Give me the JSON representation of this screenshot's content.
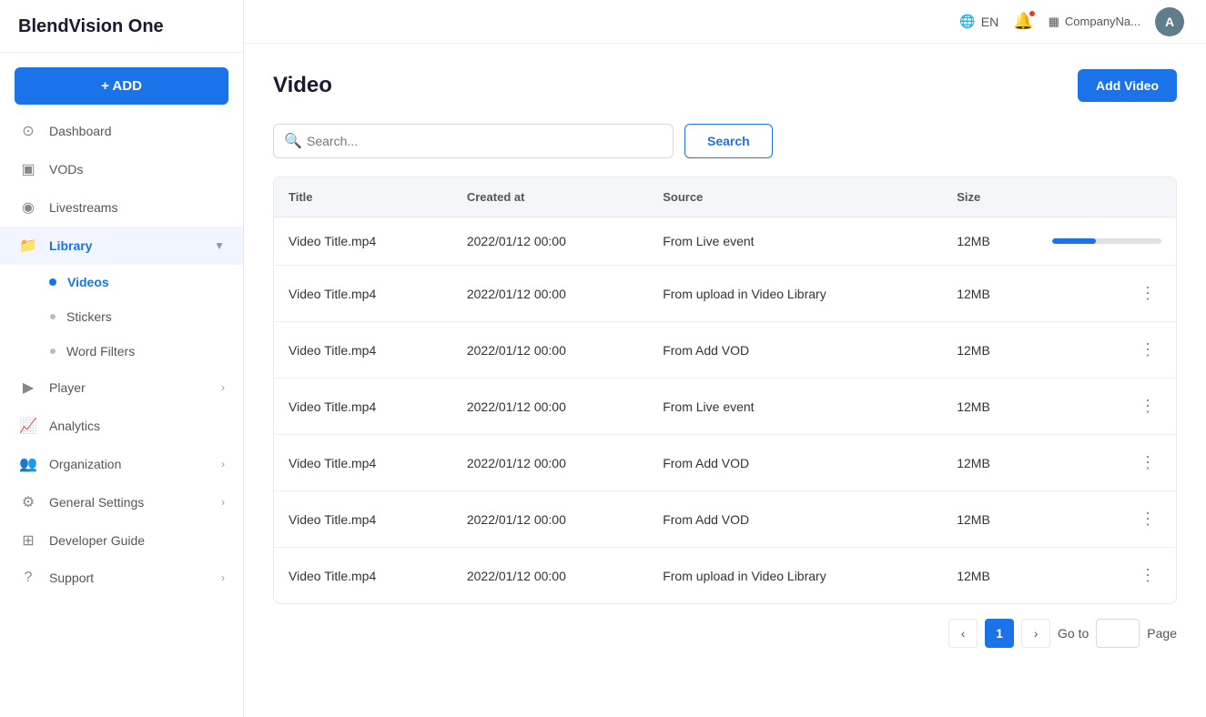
{
  "app": {
    "name": "BlendVision One"
  },
  "header": {
    "language": "EN",
    "company": "CompanyNa...",
    "avatar_initial": "A"
  },
  "sidebar": {
    "add_label": "+ ADD",
    "items": [
      {
        "id": "dashboard",
        "label": "Dashboard",
        "icon": "dashboard"
      },
      {
        "id": "vods",
        "label": "VODs",
        "icon": "vods"
      },
      {
        "id": "livestreams",
        "label": "Livestreams",
        "icon": "livestreams"
      },
      {
        "id": "library",
        "label": "Library",
        "icon": "library",
        "active": true,
        "expanded": true
      },
      {
        "id": "videos",
        "label": "Videos",
        "sub": true,
        "active": true
      },
      {
        "id": "stickers",
        "label": "Stickers",
        "sub": true
      },
      {
        "id": "word-filters",
        "label": "Word Filters",
        "sub": true
      },
      {
        "id": "player",
        "label": "Player",
        "icon": "player",
        "hasChevron": true
      },
      {
        "id": "analytics",
        "label": "Analytics",
        "icon": "analytics"
      },
      {
        "id": "organization",
        "label": "Organization",
        "icon": "organization",
        "hasChevron": true
      },
      {
        "id": "general-settings",
        "label": "General Settings",
        "icon": "settings",
        "hasChevron": true
      },
      {
        "id": "developer-guide",
        "label": "Developer Guide",
        "icon": "developer"
      },
      {
        "id": "support",
        "label": "Support",
        "icon": "support",
        "hasChevron": true
      }
    ]
  },
  "page": {
    "title": "Video",
    "add_button": "Add Video"
  },
  "search": {
    "placeholder": "Search...",
    "button_label": "Search"
  },
  "table": {
    "columns": [
      "Title",
      "Created at",
      "Source",
      "Size"
    ],
    "rows": [
      {
        "title": "Video Title.mp4",
        "created_at": "2022/01/12 00:00",
        "source": "From Live event",
        "size": "12MB",
        "has_progress": true,
        "progress": 40
      },
      {
        "title": "Video Title.mp4",
        "created_at": "2022/01/12 00:00",
        "source": "From upload in Video Library",
        "size": "12MB",
        "has_progress": false
      },
      {
        "title": "Video Title.mp4",
        "created_at": "2022/01/12 00:00",
        "source": "From Add VOD",
        "size": "12MB",
        "has_progress": false
      },
      {
        "title": "Video Title.mp4",
        "created_at": "2022/01/12 00:00",
        "source": "From Live event",
        "size": "12MB",
        "has_progress": false
      },
      {
        "title": "Video Title.mp4",
        "created_at": "2022/01/12 00:00",
        "source": "From Add VOD",
        "size": "12MB",
        "has_progress": false
      },
      {
        "title": "Video Title.mp4",
        "created_at": "2022/01/12 00:00",
        "source": "From Add VOD",
        "size": "12MB",
        "has_progress": false
      },
      {
        "title": "Video Title.mp4",
        "created_at": "2022/01/12 00:00",
        "source": "From upload in Video Library",
        "size": "12MB",
        "has_progress": false
      }
    ]
  },
  "pagination": {
    "current_page": 1,
    "goto_label": "Go to",
    "page_label": "Page"
  }
}
